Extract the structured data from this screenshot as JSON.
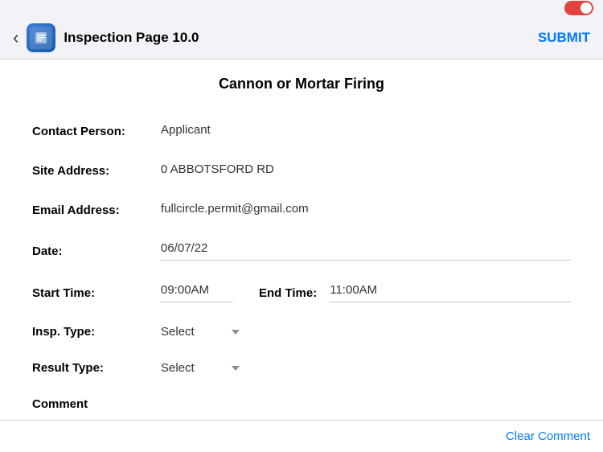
{
  "statusBar": {
    "toggleState": "on"
  },
  "header": {
    "backLabel": "‹",
    "appIconLabel": "P",
    "pageTitle": "Inspection Page 10.0",
    "submitLabel": "SUBMIT"
  },
  "form": {
    "title": "Cannon or Mortar Firing",
    "fields": {
      "contactPerson": {
        "label": "Contact Person:",
        "value": "Applicant"
      },
      "siteAddress": {
        "label": "Site Address:",
        "value": "0 ABBOTSFORD RD"
      },
      "emailAddress": {
        "label": "Email Address:",
        "value": "fullcircle.permit@gmail.com"
      },
      "date": {
        "label": "Date:",
        "value": "06/07/22"
      },
      "startTime": {
        "label": "Start Time:",
        "value": "09:00AM"
      },
      "endTime": {
        "label": "End Time:",
        "value": "11:00AM"
      },
      "inspType": {
        "label": "Insp. Type:",
        "value": "Select"
      },
      "resultType": {
        "label": "Result Type:",
        "value": "Select"
      },
      "comment": {
        "label": "Comment"
      }
    }
  },
  "bottomBar": {
    "clearCommentLabel": "Clear Comment"
  }
}
